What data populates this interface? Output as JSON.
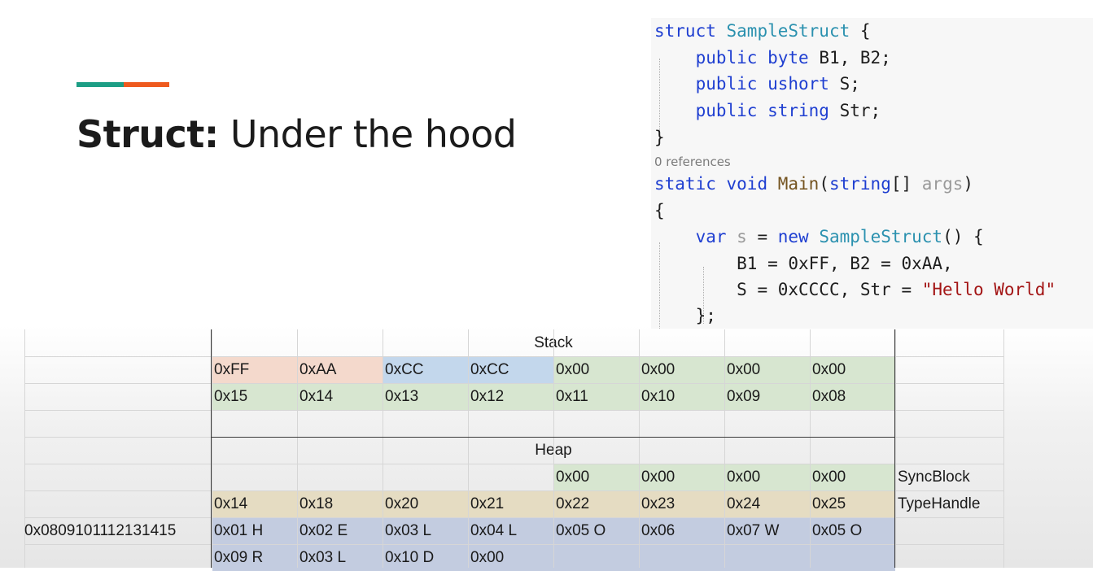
{
  "slide": {
    "title_bold": "Struct:",
    "title_rest": " Under the hood",
    "accent_colors": [
      "#1c9e85",
      "#ee5a1e"
    ]
  },
  "code": {
    "references": "0 references",
    "line1": {
      "kw": "struct",
      "ty": "SampleStruct",
      "rest": " {"
    },
    "line2": {
      "kw1": "public",
      "kw2": "byte",
      "rest": " B1, B2;"
    },
    "line3": {
      "kw1": "public",
      "kw2": "ushort",
      "rest": " S;"
    },
    "line4": {
      "kw1": "public",
      "kw2": "string",
      "rest": " Str;"
    },
    "line5": "}",
    "line6": {
      "kw1": "static",
      "kw2": "void",
      "fn": "Main",
      "open": "(",
      "kw3": "string",
      "brackets": "[] ",
      "param": "args",
      "close": ")"
    },
    "line7": "{",
    "line8": {
      "kw1": "var",
      "var": "s",
      "eq": " = ",
      "kw2": "new",
      "ty": "SampleStruct",
      "rest": "() {"
    },
    "line9": "B1 = 0xFF, B2 = 0xAA,",
    "line10": {
      "pre": "S = 0xCCCC, Str = ",
      "str": "\"Hello World\""
    },
    "line11": "};"
  },
  "grid": {
    "stack_label": "Stack",
    "heap_label": "Heap",
    "stack_values": [
      "0xFF",
      "0xAA",
      "0xCC",
      "0xCC",
      "0x00",
      "0x00",
      "0x00",
      "0x00"
    ],
    "stack_addresses": [
      "0x15",
      "0x14",
      "0x13",
      "0x12",
      "0x11",
      "0x10",
      "0x09",
      "0x08"
    ],
    "syncblock_values": [
      "0x00",
      "0x00",
      "0x00",
      "0x00"
    ],
    "syncblock_label": "SyncBlock",
    "typehandle_values": [
      "0x14",
      "0x18",
      "0x20",
      "0x21",
      "0x22",
      "0x23",
      "0x24",
      "0x25"
    ],
    "typehandle_label": "TypeHandle",
    "string_address": "0x0809101112131415",
    "string_row1": [
      "0x01 H",
      "0x02 E",
      "0x03 L",
      "0x04 L",
      "0x05 O",
      "0x06",
      "0x07 W",
      "0x05 O"
    ],
    "string_row2": [
      "0x09 R",
      "0x03 L",
      "0x10 D",
      "0x00"
    ],
    "colors": {
      "byte_fields": "#f4d9cc",
      "short_field": "#c3d7ec",
      "padding": "#d7e6d0",
      "addresses": "#d7e6d0",
      "typehandle": "#e5dcc2",
      "string_chars": "#c3cce0"
    }
  }
}
